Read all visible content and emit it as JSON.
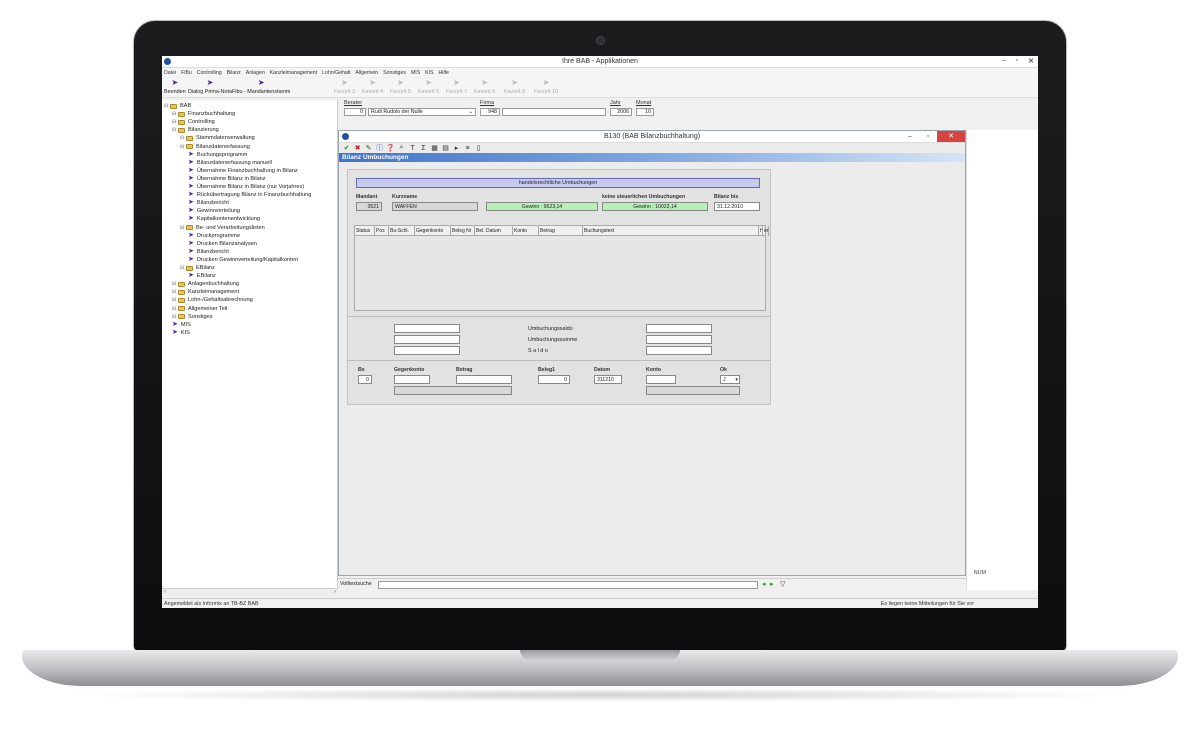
{
  "window": {
    "title": "Ihre BAB - Applikationen"
  },
  "menu": [
    "Datei",
    "FiBu",
    "Controlling",
    "Bilanz",
    "Anlagen",
    "Kanzleimanagement",
    "Lohn/Gehalt",
    "Allgemein",
    "Sonstiges",
    "MIS",
    "KIS",
    "Hilfe"
  ],
  "toolbar": {
    "buttons": [
      {
        "label": "Beenden",
        "enabled": true
      },
      {
        "label": "Dialog Prima-Nota",
        "enabled": true
      },
      {
        "label": "Fibu - Mandantenstamm",
        "enabled": true
      },
      {
        "label": "Favorit 3",
        "enabled": false
      },
      {
        "label": "Favorit 4",
        "enabled": false
      },
      {
        "label": "Favorit 5",
        "enabled": false
      },
      {
        "label": "Favorit 6",
        "enabled": false
      },
      {
        "label": "Favorit 7",
        "enabled": false
      },
      {
        "label": "Favorit 8",
        "enabled": false
      },
      {
        "label": "Favorit 9",
        "enabled": false
      },
      {
        "label": "Favorit 10",
        "enabled": false
      }
    ]
  },
  "selection": {
    "berater_label": "Berater",
    "berater_num": "0",
    "berater_name": "Rudi Rudolo der Nulle",
    "firma_label": "Firma",
    "firma_num": "948",
    "jahr_label": "Jahr",
    "jahr_value": "2006",
    "monat_label": "Monat",
    "monat_value": "10"
  },
  "tree": [
    {
      "label": "BAB",
      "level": 0,
      "type": "folder"
    },
    {
      "label": "Finanzbuchhaltung",
      "level": 1,
      "type": "folder"
    },
    {
      "label": "Controlling",
      "level": 1,
      "type": "folder"
    },
    {
      "label": "Bilanzierung",
      "level": 1,
      "type": "folder"
    },
    {
      "label": "Stammdatenverwaltung",
      "level": 2,
      "type": "folder"
    },
    {
      "label": "Bilanzdatenerfassung",
      "level": 2,
      "type": "folder"
    },
    {
      "label": "Buchungsprogramm",
      "level": 3,
      "type": "item"
    },
    {
      "label": "Bilanzdatenerfassung manuell",
      "level": 3,
      "type": "item"
    },
    {
      "label": "Übernahme Finanzbuchhaltung in Bilanz",
      "level": 3,
      "type": "item"
    },
    {
      "label": "Übernahme Bilanz in Bilanz",
      "level": 3,
      "type": "item"
    },
    {
      "label": "Übernahme Bilanz in Bilanz (nur Vorjahres)",
      "level": 3,
      "type": "item"
    },
    {
      "label": "Rückübertragung Bilanz in Finanzbuchhaltung",
      "level": 3,
      "type": "item"
    },
    {
      "label": "Bilanzbericht",
      "level": 3,
      "type": "item"
    },
    {
      "label": "Gewinnverteilung",
      "level": 3,
      "type": "item"
    },
    {
      "label": "Kapitalkontenentwicklung",
      "level": 3,
      "type": "item"
    },
    {
      "label": "Be- und Verarbeitungslisten",
      "level": 2,
      "type": "folder"
    },
    {
      "label": "Druckprogramme",
      "level": 3,
      "type": "item"
    },
    {
      "label": "Drucken Bilanzanalysen",
      "level": 3,
      "type": "item"
    },
    {
      "label": "Bilanzbericht",
      "level": 3,
      "type": "item"
    },
    {
      "label": "Drucken Gewinnverteilung/Kapitalkonten",
      "level": 3,
      "type": "item"
    },
    {
      "label": "EBilanz",
      "level": 2,
      "type": "folder"
    },
    {
      "label": "EBilanz",
      "level": 3,
      "type": "item"
    },
    {
      "label": "Anlagenbuchhaltung",
      "level": 1,
      "type": "folder"
    },
    {
      "label": "Kanzleimanagement",
      "level": 1,
      "type": "folder"
    },
    {
      "label": "Lohn-/Gehaltsabrechnung",
      "level": 1,
      "type": "folder"
    },
    {
      "label": "Allgemeiner Teil",
      "level": 1,
      "type": "folder"
    },
    {
      "label": "Sonstiges",
      "level": 1,
      "type": "folder"
    },
    {
      "label": "MIS",
      "level": 1,
      "type": "item"
    },
    {
      "label": "KIS",
      "level": 1,
      "type": "item"
    }
  ],
  "subwindow": {
    "title": "B130 (BAB Bilanzbuchhaltung)",
    "banner": "Bilanz Umbuchungen",
    "section_header": "handelsrechtliche Umbuchungen",
    "mandant_label": "Mandant",
    "mandant_value": "3521",
    "kurzname_label": "Kurzname",
    "kurzname_value": "WAFFEN",
    "steuer_label": "keine steuerlichen Umbuchungen",
    "gewinn1": "Gewinn :   9623,14",
    "gewinn2": "Gewinn :  10023,14",
    "bilanz_label": "Bilanz bis",
    "bilanz_value": "31.12.2010",
    "columns": [
      "Status",
      "Pos",
      "Bu-Schl.",
      "Gegenkonto",
      "Beleg Nr",
      "Bel. Datum",
      "Konto",
      "Betrag",
      "Buchungstext",
      "H",
      "er"
    ],
    "umbuchungssaldo": "Umbuchungssaldo",
    "umbuchungssumme": "Umbuchungssumme",
    "saldo": "S a l d o",
    "bs_label": "Bs",
    "bs_value": "0",
    "gegenkonto_label": "Gegenkonto",
    "betrag_label": "Betrag",
    "beleg1_label": "Beleg1",
    "beleg1_value": "0",
    "datum_label": "Datum",
    "datum_value": "311210",
    "konto_label": "Konto",
    "ok_label": "Ok",
    "ok_value": "J"
  },
  "search": {
    "label": "Volltextsuche"
  },
  "num_indicator": "NUM",
  "status": {
    "left": "Angemeldet als Informix an TB-BZ BAB",
    "right": "Es liegen keine Mitteilungen für Sie vor"
  },
  "colors": {
    "accent": "#3f74c8",
    "close": "#d64541",
    "green_field": "#b6f0b6",
    "header_bar": "#c7c9ef"
  }
}
